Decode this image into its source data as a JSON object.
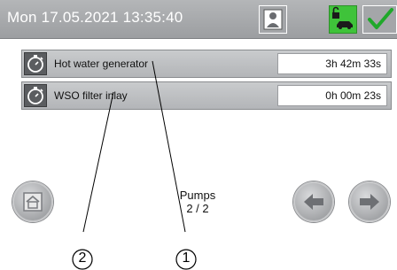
{
  "header": {
    "datetime": "Mon 17.05.2021  13:35:40",
    "user_icon": "user-profile-icon",
    "lock_icon": "unlock-vehicle-icon",
    "check_icon": "checkmark-icon",
    "colors": {
      "bar": "#a4a6a9",
      "lock_active": "#3fc33a",
      "check": "#1fa82a"
    }
  },
  "timers": [
    {
      "label": "Hot water generator",
      "value": "3h 42m 33s",
      "icon": "stopwatch-icon"
    },
    {
      "label": "WSO filter inlay",
      "value": "0h 00m 23s",
      "icon": "stopwatch-icon"
    }
  ],
  "footer": {
    "title": "Pumps",
    "page": "2 / 2",
    "home_icon": "home-icon",
    "prev_icon": "arrow-left-icon",
    "next_icon": "arrow-right-icon"
  },
  "callouts": {
    "first": "1",
    "second": "2"
  }
}
